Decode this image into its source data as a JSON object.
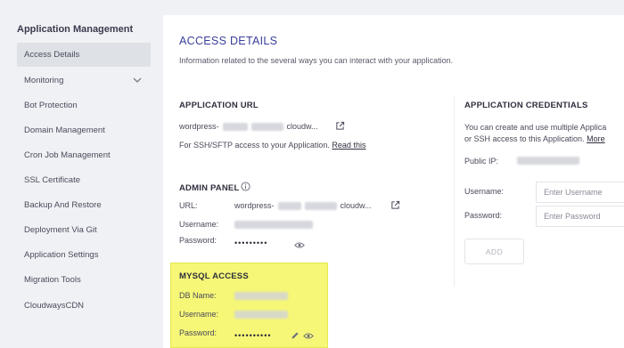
{
  "sidebar": {
    "title": "Application Management",
    "items": [
      {
        "label": "Access Details"
      },
      {
        "label": "Monitoring"
      },
      {
        "label": "Bot Protection"
      },
      {
        "label": "Domain Management"
      },
      {
        "label": "Cron Job Management"
      },
      {
        "label": "SSL Certificate"
      },
      {
        "label": "Backup And Restore"
      },
      {
        "label": "Deployment Via Git"
      },
      {
        "label": "Application Settings"
      },
      {
        "label": "Migration Tools"
      },
      {
        "label": "CloudwaysCDN"
      }
    ]
  },
  "main": {
    "title": "ACCESS DETAILS",
    "subtitle": "Information related to the several ways you can interact with your application.",
    "app_url": {
      "heading": "APPLICATION URL",
      "url_prefix": "wordpress-",
      "url_suffix": "cloudw...",
      "ssh_note": "For SSH/SFTP access to your Application.",
      "read_this": "Read this"
    },
    "admin_panel": {
      "heading": "ADMIN PANEL",
      "url_label": "URL:",
      "url_prefix": "wordpress-",
      "url_suffix": "cloudw...",
      "username_label": "Username:",
      "password_label": "Password:",
      "password_mask": "•••••••••"
    },
    "mysql": {
      "heading": "MYSQL ACCESS",
      "db_name_label": "DB Name:",
      "username_label": "Username:",
      "password_label": "Password:",
      "password_mask": "••••••••••"
    },
    "credentials": {
      "heading": "APPLICATION CREDENTIALS",
      "desc_line1": "You can create and use multiple Applica",
      "desc_line2": "or SSH access to this Application.",
      "more": "More",
      "public_ip_label": "Public IP:",
      "username_label": "Username:",
      "username_placeholder": "Enter Username",
      "password_label": "Password:",
      "password_placeholder": "Enter Password",
      "add_label": "ADD"
    }
  },
  "colors": {
    "accent": "#3a3f9a",
    "highlight": "#f6f777",
    "sidebar_active": "#dee1e6"
  }
}
